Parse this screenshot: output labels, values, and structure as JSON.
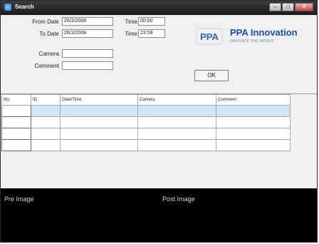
{
  "window": {
    "title": "Search",
    "controls": [
      "–",
      "□",
      "X"
    ]
  },
  "form": {
    "from_date_label": "From Date",
    "from_date_value": "26/3/2008",
    "to_date_label": "To Date",
    "to_date_value": "26/3/2008",
    "time_label": "Time",
    "from_time_value": "00:00",
    "to_time_value": "23:59",
    "camera_label": "Camera",
    "camera_value": "",
    "comment_label": "Comment",
    "comment_value": "",
    "ok_label": "OK"
  },
  "logo": {
    "name": "PPA Innovation",
    "tagline": "INNOVATE THE WORLD",
    "mark": "PPA",
    "mark_color": "#2f67b8"
  },
  "grid": {
    "columns": [
      "No.",
      "ID",
      "Date/Time",
      "Camera",
      "Comment"
    ],
    "rows": 4,
    "selected_row": 0,
    "selection_color": "#cfe6f5"
  },
  "preview": {
    "pre_label": "Pre Image",
    "post_label": "Post Image"
  }
}
